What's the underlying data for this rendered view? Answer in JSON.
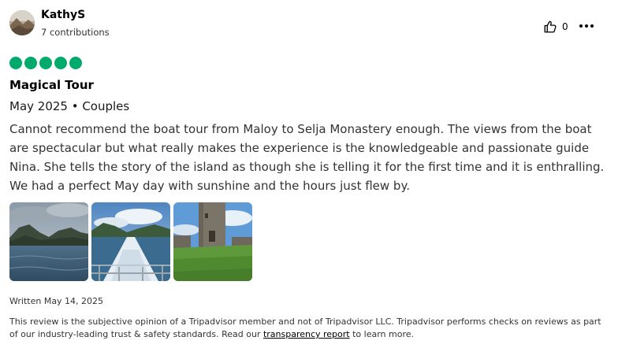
{
  "review": {
    "author": {
      "name": "KathyS",
      "contributions": "7 contributions",
      "avatar_icon": "avatar-photo"
    },
    "actions": {
      "like_icon": "thumbs-up-icon",
      "like_count": "0",
      "more_icon": "more-options-icon"
    },
    "rating": {
      "value": 5,
      "max": 5,
      "color": "#00aa6c"
    },
    "title": "Magical Tour",
    "date_and_type": "May 2025 • Couples",
    "text": "Cannot recommend the boat tour from Maloy to Selja Monastery enough. The views from the boat are spectacular but what really makes the experience is the knowledgeable and passionate guide Nina. She tells the story of the island as though she is telling it for the first time and it is enthralling. We had a perfect May day with sunshine and the hours just flew by.",
    "photos": [
      "fjord-mountains-photo",
      "boat-wake-photo",
      "stone-tower-photo"
    ],
    "written_date": "Written May 14, 2025",
    "disclaimer": {
      "before": "This review is the subjective opinion of a Tripadvisor member and not of Tripadvisor LLC. Tripadvisor performs checks on reviews as part of our industry-leading trust & safety standards. Read our ",
      "link": "transparency report",
      "after": " to learn more."
    }
  }
}
